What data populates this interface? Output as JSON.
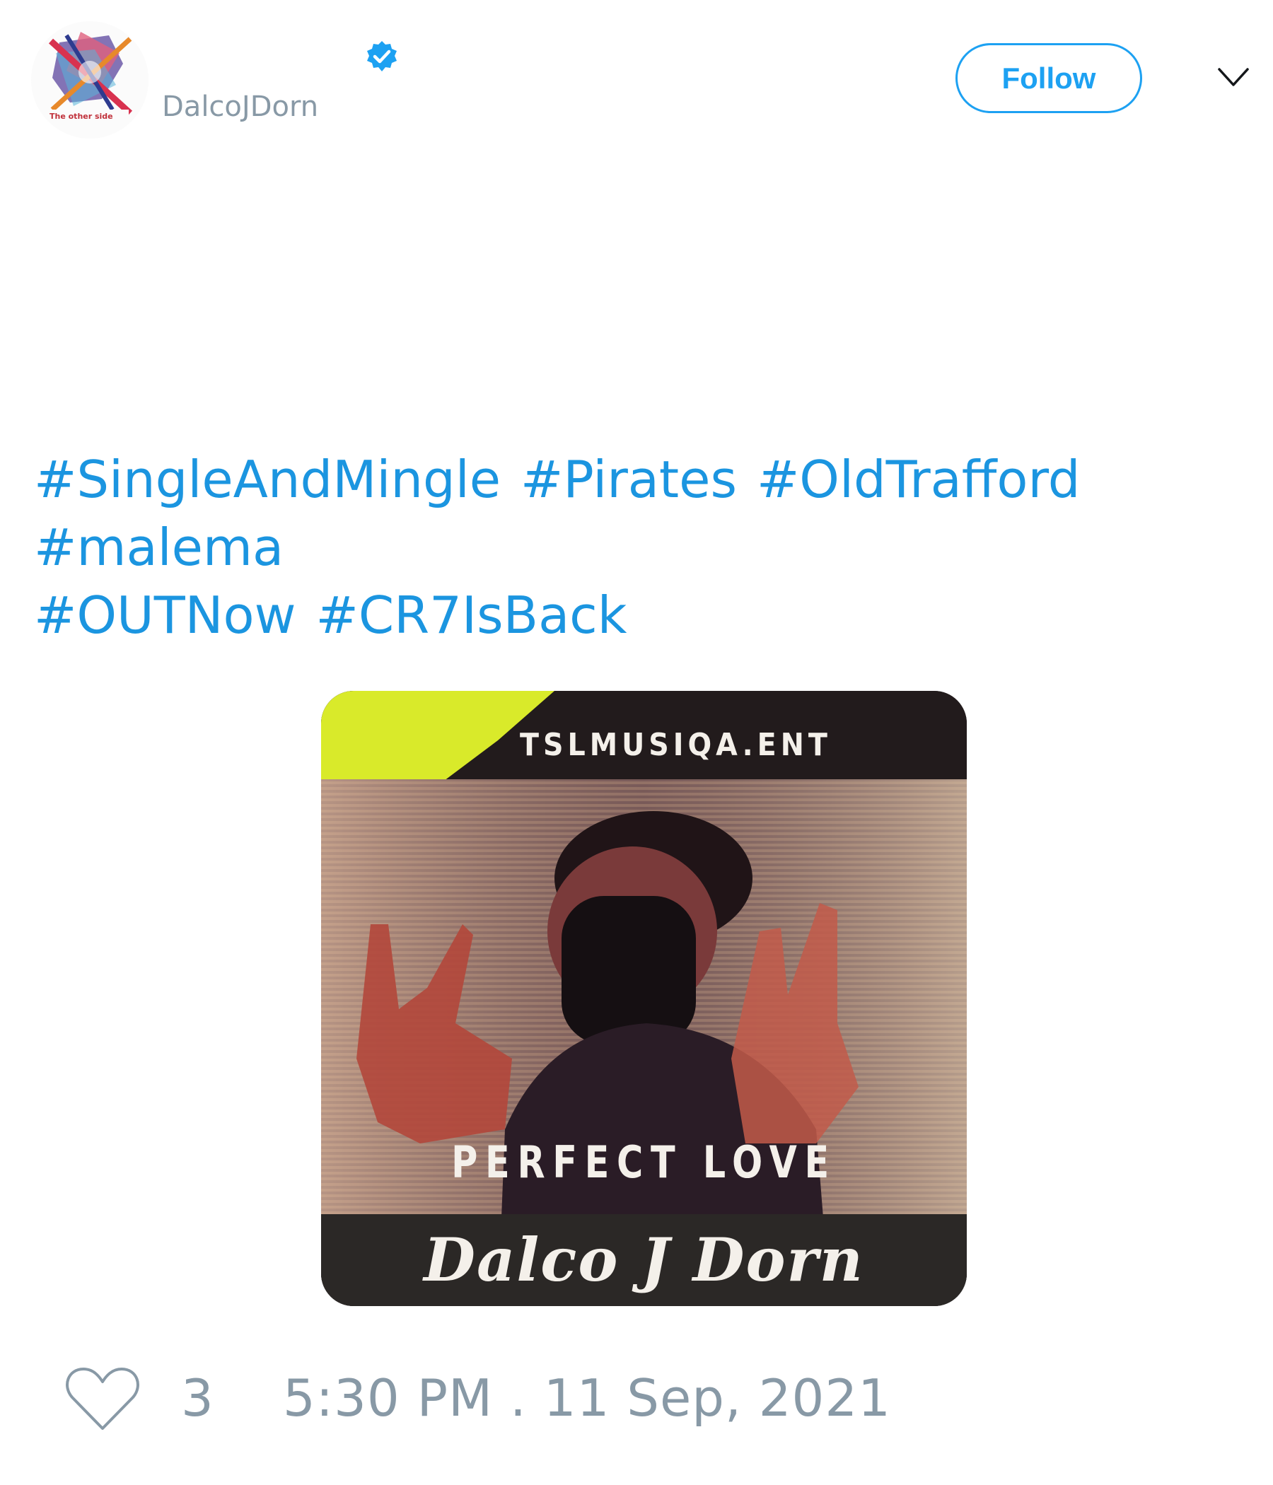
{
  "header": {
    "handle": "DalcoJDorn",
    "follow_label": "Follow",
    "avatar_text": "The other side",
    "icons": {
      "verified": "verified-badge-icon",
      "caret": "chevron-down-icon"
    }
  },
  "tweet": {
    "lines": [
      [
        "#SingleAndMingle",
        "#Pirates",
        "#OldTrafford"
      ],
      [
        "#malema"
      ],
      [
        "#OUTNow",
        "#CR7IsBack"
      ]
    ]
  },
  "media": {
    "top_text": "TSLMUSIQA.ENT",
    "title": "PERFECT LOVE",
    "artist": "Dalco J Dorn"
  },
  "footer": {
    "like_count": "3",
    "timestamp": "5:30 PM . 11 Sep, 2021",
    "icons": {
      "like": "heart-icon"
    }
  },
  "colors": {
    "accent": "#1da1f2",
    "link": "#1b95e0",
    "muted": "#8899a6"
  }
}
